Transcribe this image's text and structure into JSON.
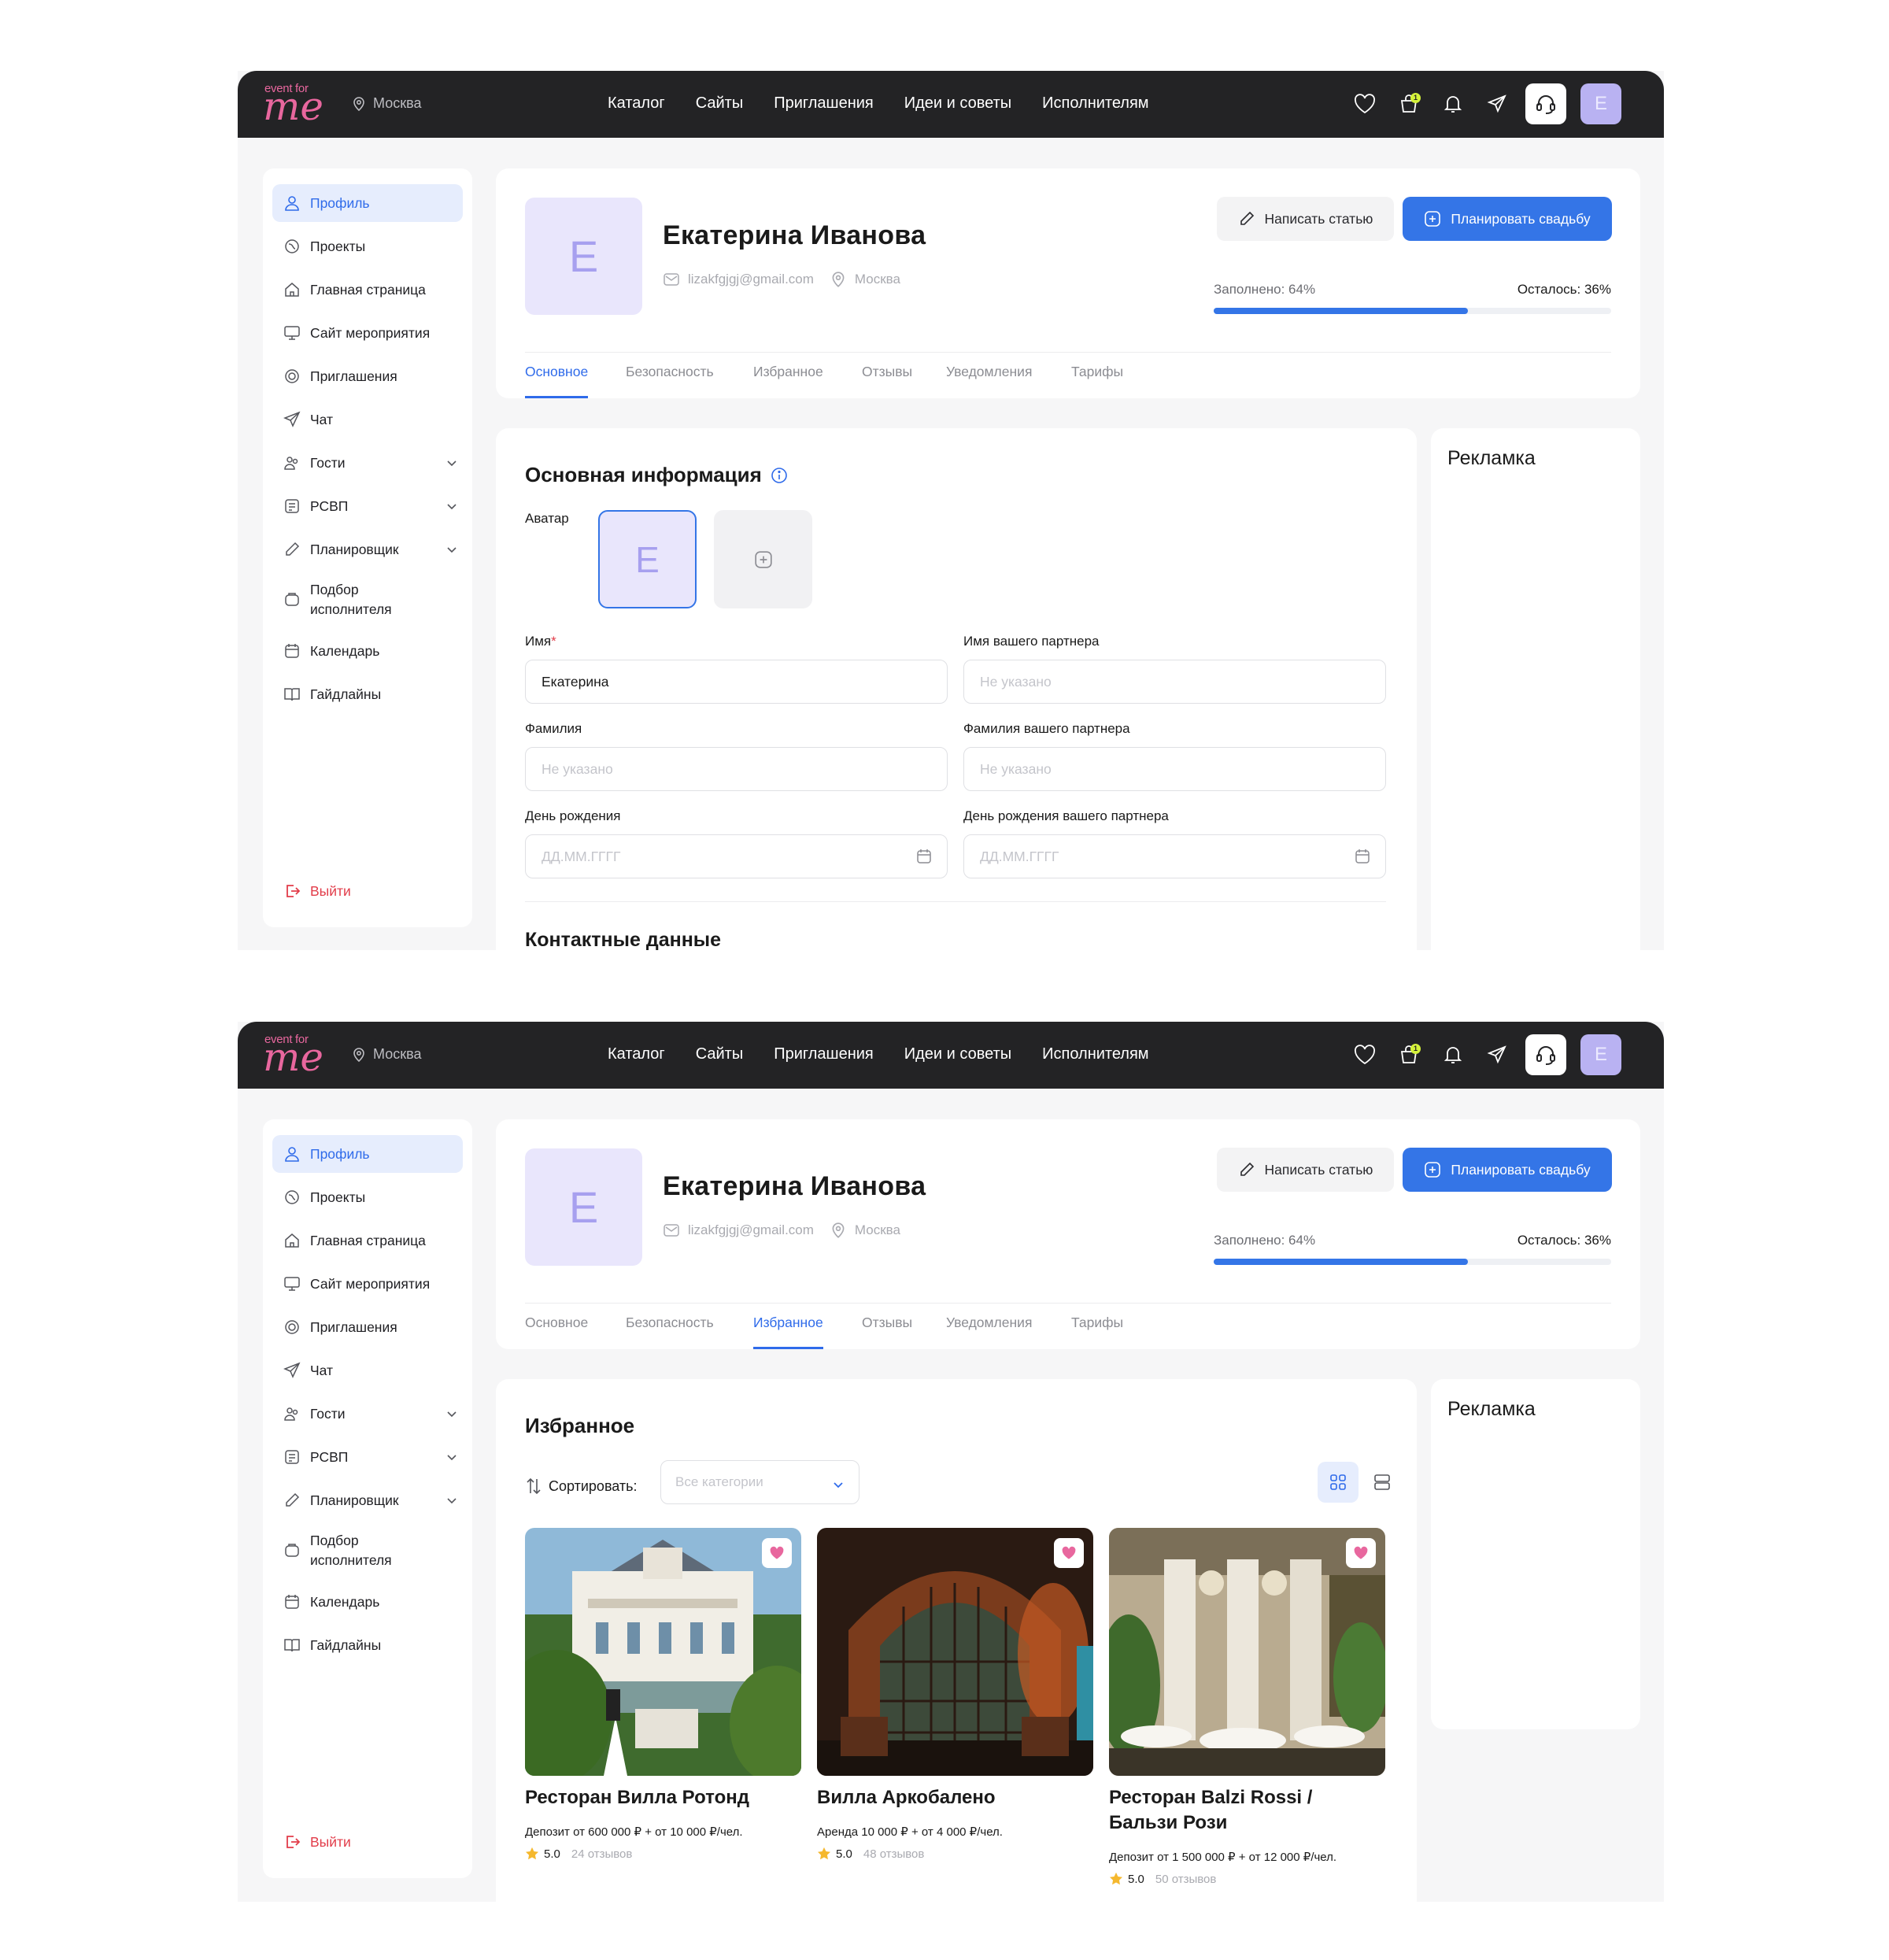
{
  "header": {
    "logo_top": "event for",
    "logo_bottom": "me",
    "city": "Москва",
    "nav": [
      "Каталог",
      "Сайты",
      "Приглашения",
      "Идеи и советы",
      "Исполнителям"
    ],
    "cart_badge": "1",
    "avatar_letter": "E",
    "icons": [
      "heart-icon",
      "cart-icon",
      "bell-icon",
      "send-icon",
      "support-icon"
    ]
  },
  "sidebar": {
    "items": [
      {
        "label": "Профиль",
        "icon": "user-icon"
      },
      {
        "label": "Проекты",
        "icon": "projects-icon"
      },
      {
        "label": "Главная страница",
        "icon": "home-icon"
      },
      {
        "label": "Сайт мероприятия",
        "icon": "monitor-icon"
      },
      {
        "label": "Приглашения",
        "icon": "invitation-icon"
      },
      {
        "label": "Чат",
        "icon": "chat-icon"
      },
      {
        "label": "Гости",
        "icon": "guests-icon"
      },
      {
        "label": "РСВП",
        "icon": "rsvp-icon"
      },
      {
        "label": "Планировщик",
        "icon": "pen-icon"
      },
      {
        "label": "Подбор исполнителя",
        "icon": "vendor-icon"
      },
      {
        "label": "Календарь",
        "icon": "calendar-icon"
      },
      {
        "label": "Гайдлайны",
        "icon": "book-icon"
      }
    ],
    "logout": "Выйти"
  },
  "profile": {
    "avatar_letter": "E",
    "name": "Екатерина Иванова",
    "email": "lizakfgjgj@gmail.com",
    "city": "Москва",
    "write_article": "Написать статью",
    "plan_wedding": "Планировать свадьбу",
    "filled": "Заполнено: 64%",
    "remaining": "Осталось: 36%",
    "progress_fraction": 0.64,
    "tabs": [
      "Основное",
      "Безопасность",
      "Избранное",
      "Отзывы",
      "Уведомления",
      "Тарифы"
    ]
  },
  "ads_title": "Рекламка",
  "basic": {
    "title": "Основная информация",
    "avatar_label": "Аватар",
    "avatar_letter": "E",
    "first_name_label": "Имя",
    "required_mark": "*",
    "first_name_value": "Екатерина",
    "partner_name_label": "Имя вашего партнера",
    "last_name_label": "Фамилия",
    "partner_last_name_label": "Фамилия вашего партнера",
    "birthday_label": "День рождения",
    "partner_birthday_label": "День рождения вашего партнера",
    "placeholder_empty": "Не указано",
    "placeholder_date": "ДД.ММ.ГГГГ",
    "contacts_title": "Контактные данные"
  },
  "favorites": {
    "title": "Избранное",
    "sort_label": "Сортировать:",
    "category_placeholder": "Все категории",
    "cards": [
      {
        "title": "Ресторан Вилла Ротонд",
        "price": "Депозит от 600 000 ₽ + от 10 000 ₽/чел.",
        "rating": "5.0",
        "reviews": "24 отзывов"
      },
      {
        "title": "Вилла Аркобалено",
        "price": "Аренда 10 000 ₽ + от 4 000 ₽/чел.",
        "rating": "5.0",
        "reviews": "48 отзывов"
      },
      {
        "title": "Ресторан Balzi Rossi / Бальзи Рози",
        "price": "Депозит от 1 500 000 ₽ + от 12 000 ₽/чел.",
        "rating": "5.0",
        "reviews": "50 отзывов"
      }
    ]
  },
  "colors": {
    "accent": "#3475e7",
    "topbar": "#232325",
    "avatar": "#e9e6fc",
    "logout": "#e23d4a",
    "heart": "#e8679e"
  }
}
